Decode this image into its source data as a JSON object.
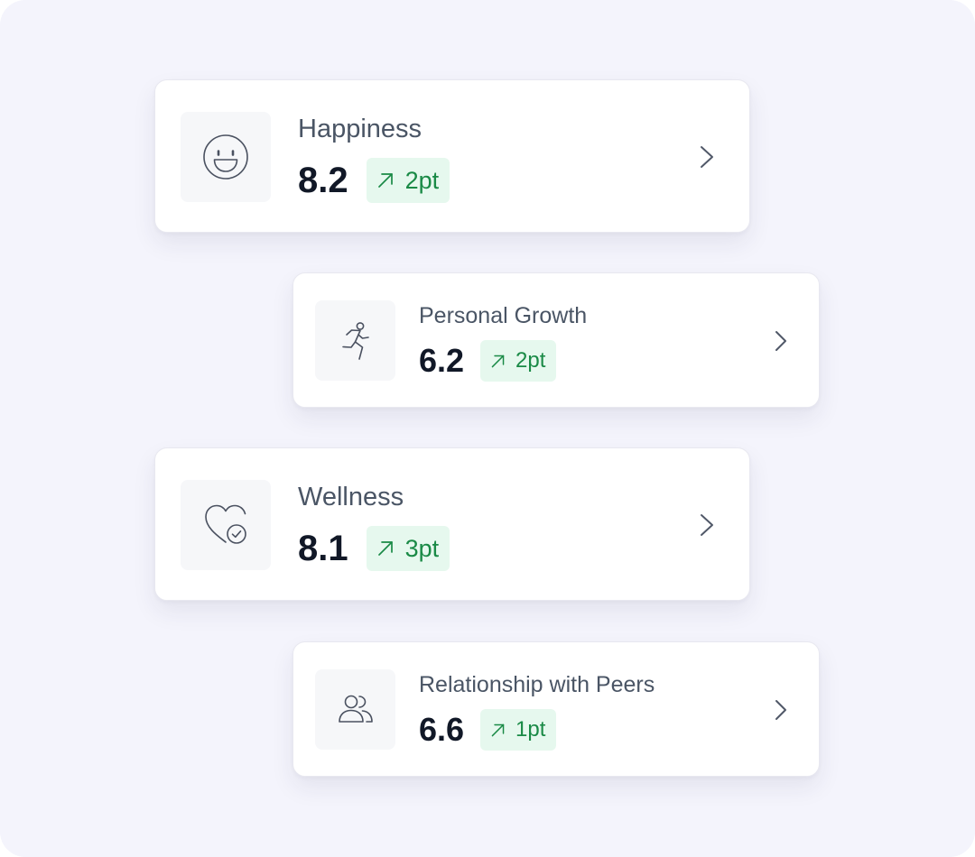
{
  "cards": [
    {
      "label": "Happiness",
      "score": "8.2",
      "change": "2pt",
      "icon": "smile-icon"
    },
    {
      "label": "Personal Growth",
      "score": "6.2",
      "change": "2pt",
      "icon": "running-person-icon"
    },
    {
      "label": "Wellness",
      "score": "8.1",
      "change": "3pt",
      "icon": "heart-check-icon"
    },
    {
      "label": "Relationship with Peers",
      "score": "6.6",
      "change": "1pt",
      "icon": "users-icon"
    }
  ],
  "colors": {
    "background": "#f4f4fc",
    "card": "#ffffff",
    "badge_bg": "#e6f8ee",
    "badge_text": "#1a8a46",
    "score_text": "#111827",
    "label_text": "#4a5565"
  }
}
